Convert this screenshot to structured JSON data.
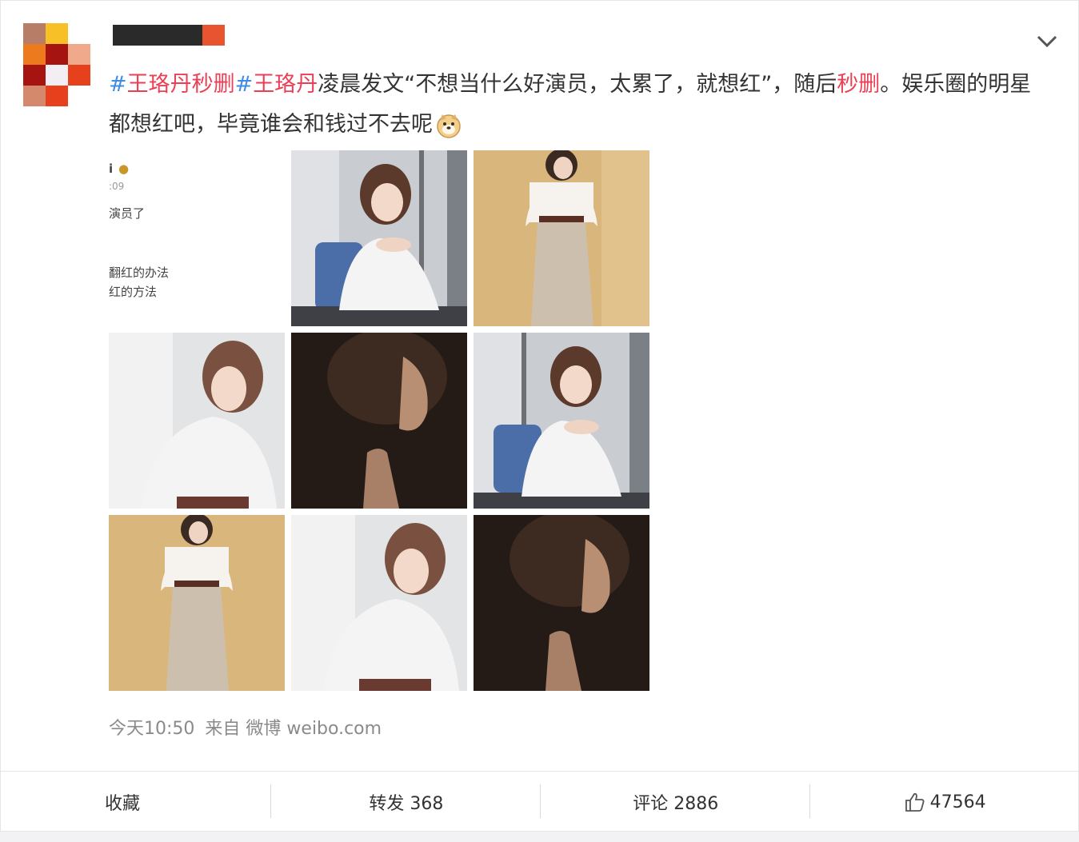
{
  "post": {
    "text_parts": [
      {
        "hash": "#",
        "tag": "王珞丹秒删"
      },
      {
        "hash": "#",
        "tag": "王珞丹"
      },
      {
        "plain": "凌晨发文“不想当什么好演员，太累了，就想红”，随后"
      },
      {
        "tag": "秒删"
      },
      {
        "plain": "。娱乐圈的明星都想红吧，毕竟谁会和钱过不去呢"
      }
    ],
    "emoji": "doge-emoji",
    "screenshot_thumb": {
      "line1": "ⅰ",
      "line2": ":09",
      "line3": "演员了",
      "line4": "翻红的办法",
      "line5": "红的方法"
    },
    "timestamp": "今天10:50",
    "source_prefix": "来自",
    "source_name": "微博 weibo.com"
  },
  "actions": {
    "favorite": "收藏",
    "repost": "转发 368",
    "comment": "评论 2886",
    "like_count": "47564"
  },
  "colors": {
    "hashtag_red": "#eb3f55",
    "hash_blue": "#3f8be6",
    "meta_gray": "#8a8a8a"
  }
}
